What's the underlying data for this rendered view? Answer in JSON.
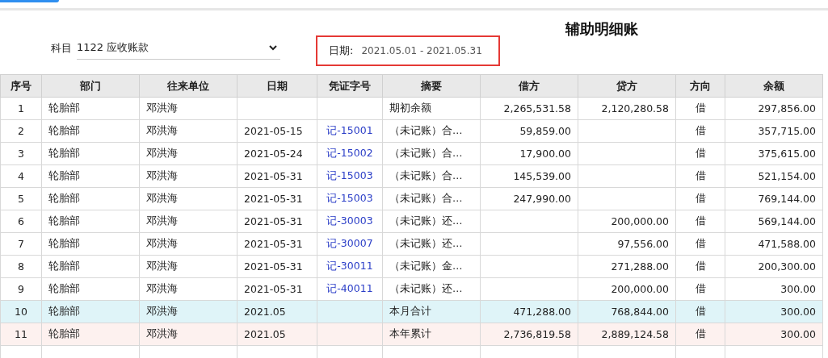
{
  "title": "辅助明细账",
  "filters": {
    "subject_label": "科目",
    "subject_value": "1122 应收账款",
    "date_label": "日期:",
    "date_value": "2021.05.01 - 2021.05.31"
  },
  "table": {
    "columns": [
      "序号",
      "部门",
      "往来单位",
      "日期",
      "凭证字号",
      "摘要",
      "借方",
      "贷方",
      "方向",
      "余额"
    ],
    "rows": [
      {
        "kind": "normal",
        "cells": [
          "1",
          "轮胎部",
          "邓洪海",
          "",
          "",
          "期初余额",
          "2,265,531.58",
          "2,120,280.58",
          "借",
          "297,856.00"
        ]
      },
      {
        "kind": "normal",
        "cells": [
          "2",
          "轮胎部",
          "邓洪海",
          "2021-05-15",
          "记-15001",
          "（未记账）合…",
          "59,859.00",
          "",
          "借",
          "357,715.00"
        ]
      },
      {
        "kind": "normal",
        "cells": [
          "3",
          "轮胎部",
          "邓洪海",
          "2021-05-24",
          "记-15002",
          "（未记账）合…",
          "17,900.00",
          "",
          "借",
          "375,615.00"
        ]
      },
      {
        "kind": "normal",
        "cells": [
          "4",
          "轮胎部",
          "邓洪海",
          "2021-05-31",
          "记-15003",
          "（未记账）合…",
          "145,539.00",
          "",
          "借",
          "521,154.00"
        ]
      },
      {
        "kind": "normal",
        "cells": [
          "5",
          "轮胎部",
          "邓洪海",
          "2021-05-31",
          "记-15003",
          "（未记账）合…",
          "247,990.00",
          "",
          "借",
          "769,144.00"
        ]
      },
      {
        "kind": "normal",
        "cells": [
          "6",
          "轮胎部",
          "邓洪海",
          "2021-05-31",
          "记-30003",
          "（未记账）还…",
          "",
          "200,000.00",
          "借",
          "569,144.00"
        ]
      },
      {
        "kind": "normal",
        "cells": [
          "7",
          "轮胎部",
          "邓洪海",
          "2021-05-31",
          "记-30007",
          "（未记账）还…",
          "",
          "97,556.00",
          "借",
          "471,588.00"
        ]
      },
      {
        "kind": "normal",
        "cells": [
          "8",
          "轮胎部",
          "邓洪海",
          "2021-05-31",
          "记-30011",
          "（未记账）金…",
          "",
          "271,288.00",
          "借",
          "200,300.00"
        ]
      },
      {
        "kind": "normal",
        "cells": [
          "9",
          "轮胎部",
          "邓洪海",
          "2021-05-31",
          "记-40011",
          "（未记账）还…",
          "",
          "200,000.00",
          "借",
          "300.00"
        ]
      },
      {
        "kind": "month_total",
        "cells": [
          "10",
          "轮胎部",
          "邓洪海",
          "2021.05",
          "",
          "本月合计",
          "471,288.00",
          "768,844.00",
          "借",
          "300.00"
        ]
      },
      {
        "kind": "year_total",
        "cells": [
          "11",
          "轮胎部",
          "邓洪海",
          "2021.05",
          "",
          "本年累计",
          "2,736,819.58",
          "2,889,124.58",
          "借",
          "300.00"
        ]
      }
    ]
  }
}
